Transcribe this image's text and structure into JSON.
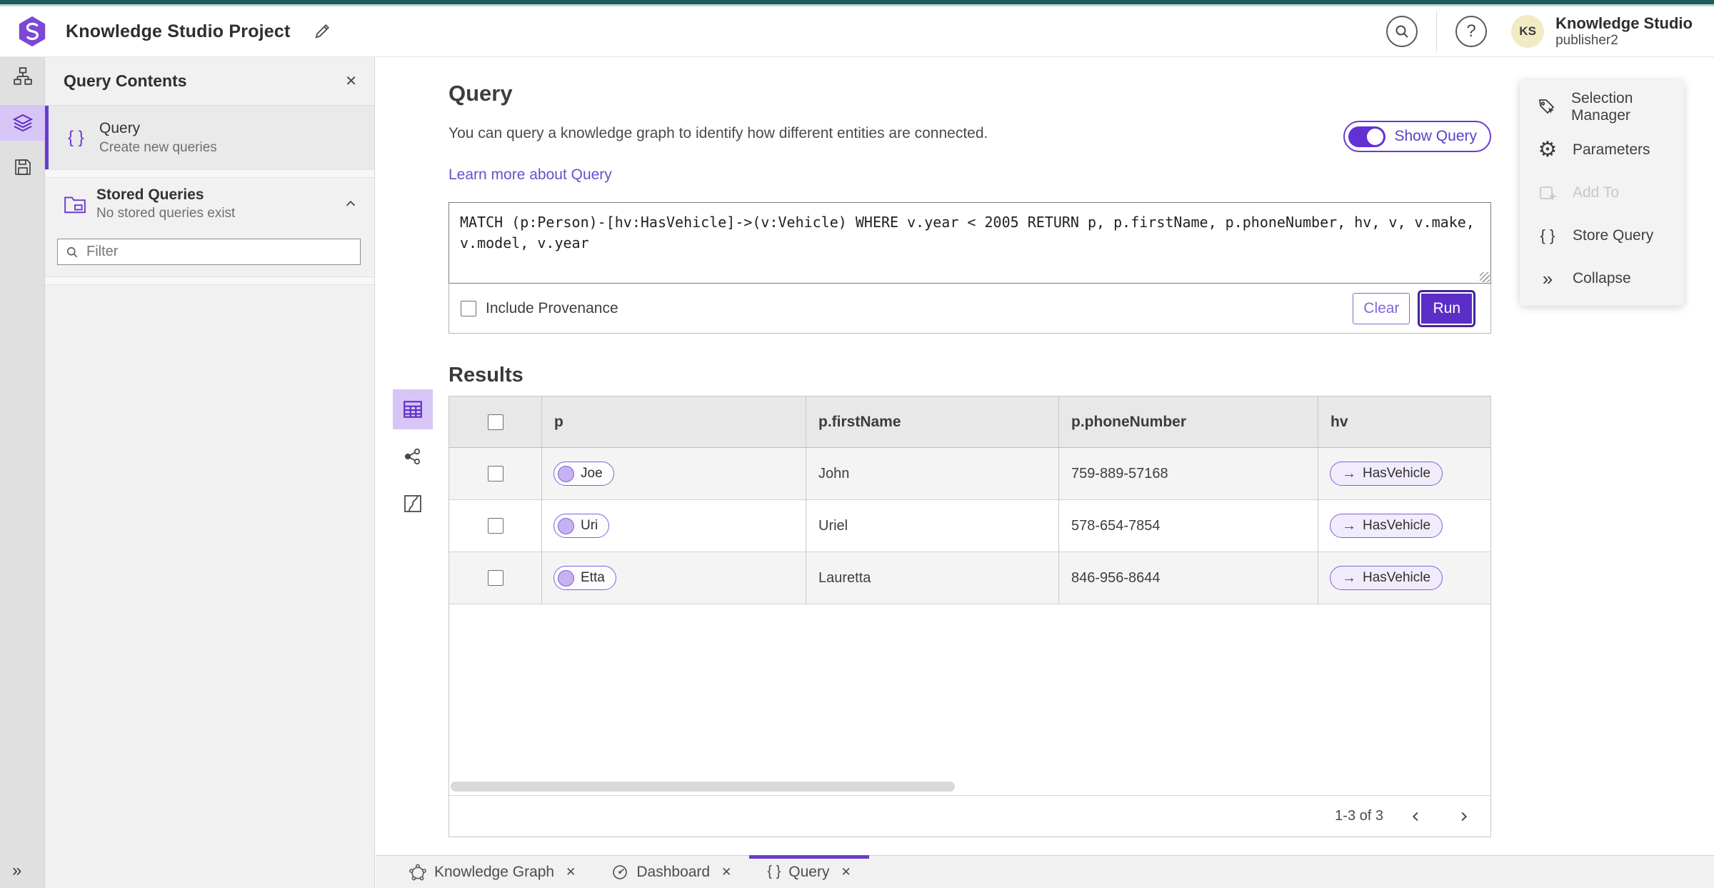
{
  "colors": {
    "accent": "#6a3bd1",
    "accent_deep": "#5b2fc7",
    "teal_top": "#1e5c59",
    "selected_bg": "#d8c5f7"
  },
  "header": {
    "title": "Knowledge Studio Project",
    "product": "Knowledge Studio",
    "user": "publisher2",
    "avatar": "KS"
  },
  "icons": {
    "close": "✕",
    "braces": "{ }",
    "collapse": "»",
    "help": "?",
    "arrow_right": "→",
    "gear": "⚙"
  },
  "panel": {
    "title": "Query Contents",
    "query_item": {
      "title": "Query",
      "subtitle": "Create new queries"
    },
    "stored": {
      "title": "Stored Queries",
      "subtitle": "No stored queries exist"
    },
    "filter_placeholder": "Filter"
  },
  "query_section": {
    "title": "Query",
    "description": "You can query a knowledge graph to identify how different entities are connected.",
    "learn_link": "Learn more about Query",
    "show_query_label": "Show Query",
    "query_text": "MATCH (p:Person)-[hv:HasVehicle]->(v:Vehicle) WHERE v.year < 2005 RETURN p, p.firstName, p.phoneNumber, hv, v, v.make, v.model, v.year",
    "include_provenance_label": "Include Provenance",
    "clear_label": "Clear",
    "run_label": "Run"
  },
  "results": {
    "title": "Results",
    "columns": [
      "p",
      "p.firstName",
      "p.phoneNumber",
      "hv"
    ],
    "rows": [
      {
        "p": "Joe",
        "firstName": "John",
        "phone": "759-889-57168",
        "hv": "HasVehicle"
      },
      {
        "p": "Uri",
        "firstName": "Uriel",
        "phone": "578-654-7854",
        "hv": "HasVehicle"
      },
      {
        "p": "Etta",
        "firstName": "Lauretta",
        "phone": "846-956-8644",
        "hv": "HasVehicle"
      }
    ],
    "pagination": "1-3 of 3"
  },
  "context_menu": {
    "items": [
      {
        "label": "Selection Manager",
        "disabled": false
      },
      {
        "label": "Parameters",
        "disabled": false
      },
      {
        "label": "Add To",
        "disabled": true
      },
      {
        "label": "Store Query",
        "disabled": false
      },
      {
        "label": "Collapse",
        "disabled": false
      }
    ]
  },
  "tabs": [
    {
      "label": "Knowledge Graph",
      "active": false
    },
    {
      "label": "Dashboard",
      "active": false
    },
    {
      "label": "Query",
      "active": true
    }
  ]
}
